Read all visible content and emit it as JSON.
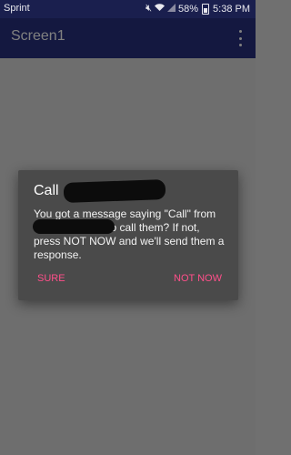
{
  "status_bar": {
    "carrier": "Sprint",
    "battery": "58%",
    "time": "5:38 PM",
    "icons": [
      "mute-icon",
      "wifi-icon",
      "signal-icon",
      "battery-icon"
    ]
  },
  "app_bar": {
    "title": "Screen1",
    "overflow_icon": "more-vert-icon"
  },
  "dialog": {
    "title": "Call",
    "message": "You got a message saying \"Call\" from                Would you like to call them? If not, press NOT NOW and we'll send them a response.",
    "buttons": {
      "positive": "SURE",
      "negative": "NOT NOW"
    }
  },
  "colors": {
    "accent": "#ff4f8a",
    "app_bar": "#283080",
    "dialog_bg": "#4a4a4a"
  }
}
